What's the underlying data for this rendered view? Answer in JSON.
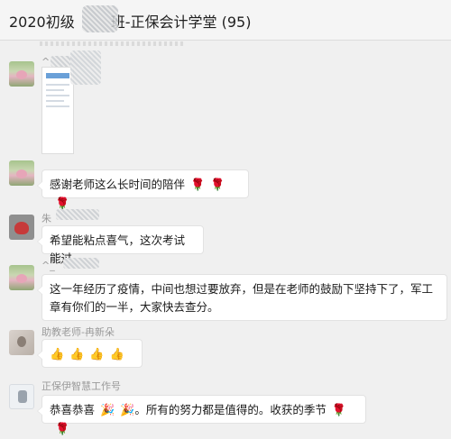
{
  "header": {
    "title": "2020初级",
    "title_suffix": "班-正保会计学堂 (95)"
  },
  "messages": [
    {
      "name": "^",
      "kind": "image"
    },
    {
      "text": "感谢老师这么长时间的陪伴",
      "emojis": [
        "🌹",
        "🌹",
        "🌹"
      ]
    },
    {
      "name": "朱",
      "text": "希望能粘点喜气，这次考试能过"
    },
    {
      "name": "^_^",
      "text": "这一年经历了疫情，中间也想过要放弃，但是在老师的鼓励下坚持下了，军工章有你们的一半，大家快去查分。"
    },
    {
      "name": "助教老师-冉新朵",
      "emojis": [
        "👍",
        "👍",
        "👍",
        "👍"
      ]
    },
    {
      "name": "正保伊智慧工作号",
      "text_a": "恭喜恭喜",
      "emojis_mid": [
        "🎉",
        "🎉"
      ],
      "text_b": "。所有的努力都是值得的。收获的季节",
      "emojis": [
        "🌹",
        "🌹"
      ]
    }
  ]
}
